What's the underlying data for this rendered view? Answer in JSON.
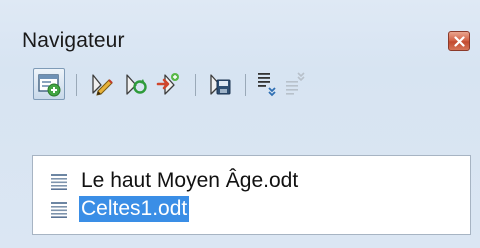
{
  "window": {
    "title": "Navigateur"
  },
  "toolbar": {
    "buttons": [
      {
        "name": "toggle-content-view-icon",
        "active": true
      },
      {
        "name": "edit-icon"
      },
      {
        "name": "update-icon"
      },
      {
        "name": "insert-icon"
      },
      {
        "name": "save-as-icon"
      },
      {
        "name": "promote-level-icon"
      },
      {
        "name": "demote-level-icon"
      }
    ]
  },
  "documents": [
    {
      "label": "Le haut Moyen Âge.odt",
      "selected": false
    },
    {
      "label": "Celtes1.odt",
      "selected": true
    }
  ],
  "colors": {
    "selection": "#3a8ee6",
    "close_button": "#d4664a"
  }
}
